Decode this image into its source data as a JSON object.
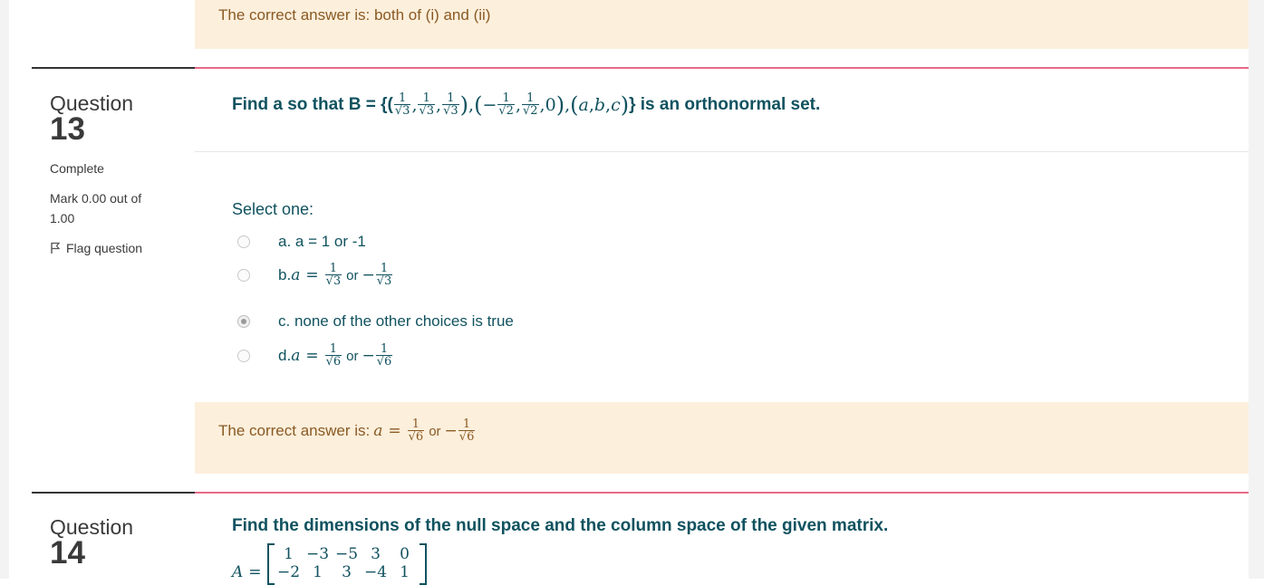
{
  "top_feedback": {
    "text": "The correct answer is: both of (i) and (ii)"
  },
  "q13": {
    "label": "Question",
    "number": "13",
    "state": "Complete",
    "grade": "Mark 0.00 out of 1.00",
    "flag_label": "Flag question",
    "text_before": "Find a so that B = {(",
    "text_after": "} is an orthonormal set.",
    "prompt": "Select one:",
    "options": [
      {
        "label": "a. a = 1 or -1",
        "checked": false
      },
      {
        "prefix": "b.",
        "math": "a = 1/√3 or −1/√3",
        "checked": false
      },
      {
        "label": "c. none of the other choices is true",
        "checked": true
      },
      {
        "prefix": "d.",
        "math": "a = 1/√6 or −1/√6",
        "checked": false
      }
    ],
    "feedback_prefix": "The correct answer is:",
    "or_word": "or"
  },
  "q14": {
    "label": "Question",
    "number": "14",
    "text": "Find the dimensions of the null space and the column space of the given matrix.",
    "matrix_label": "A",
    "matrix_rows": [
      [
        "1",
        "−3",
        "−5",
        "3",
        "0"
      ],
      [
        "−2",
        "1",
        "3",
        "−4",
        "1"
      ]
    ]
  },
  "colors": {
    "feedback_bg": "#fcefdc",
    "feedback_text": "#8a5a23",
    "question_text": "#10525f",
    "separator": "#e86a87"
  },
  "icons": {
    "flag": "flag-icon",
    "radio": "radio-icon"
  }
}
